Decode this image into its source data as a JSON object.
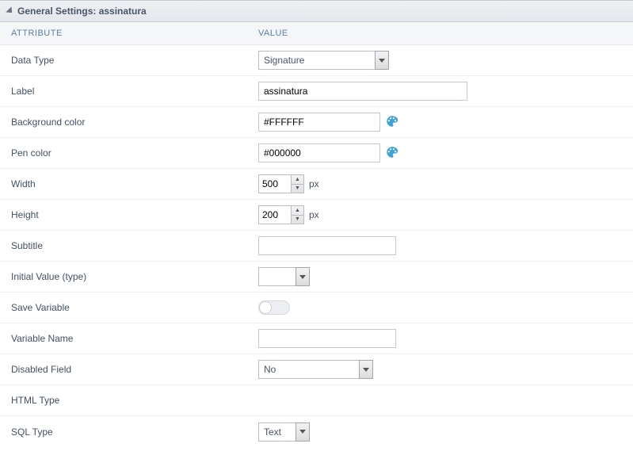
{
  "header": {
    "title": "General Settings: assinatura"
  },
  "columns": {
    "attribute": "ATTRIBUTE",
    "value": "VALUE"
  },
  "rows": {
    "data_type": {
      "label": "Data Type",
      "value": "Signature"
    },
    "label": {
      "label": "Label",
      "value": "assinatura"
    },
    "bg_color": {
      "label": "Background color",
      "value": "#FFFFFF"
    },
    "pen_color": {
      "label": "Pen color",
      "value": "#000000"
    },
    "width": {
      "label": "Width",
      "value": "500",
      "unit": "px"
    },
    "height": {
      "label": "Height",
      "value": "200",
      "unit": "px"
    },
    "subtitle": {
      "label": "Subtitle",
      "value": ""
    },
    "initial_value": {
      "label": "Initial Value (type)",
      "value": ""
    },
    "save_variable": {
      "label": "Save Variable",
      "on": false
    },
    "variable_name": {
      "label": "Variable Name",
      "value": ""
    },
    "disabled_field": {
      "label": "Disabled Field",
      "value": "No"
    },
    "html_type": {
      "label": "HTML Type"
    },
    "sql_type": {
      "label": "SQL Type",
      "value": "Text"
    }
  }
}
